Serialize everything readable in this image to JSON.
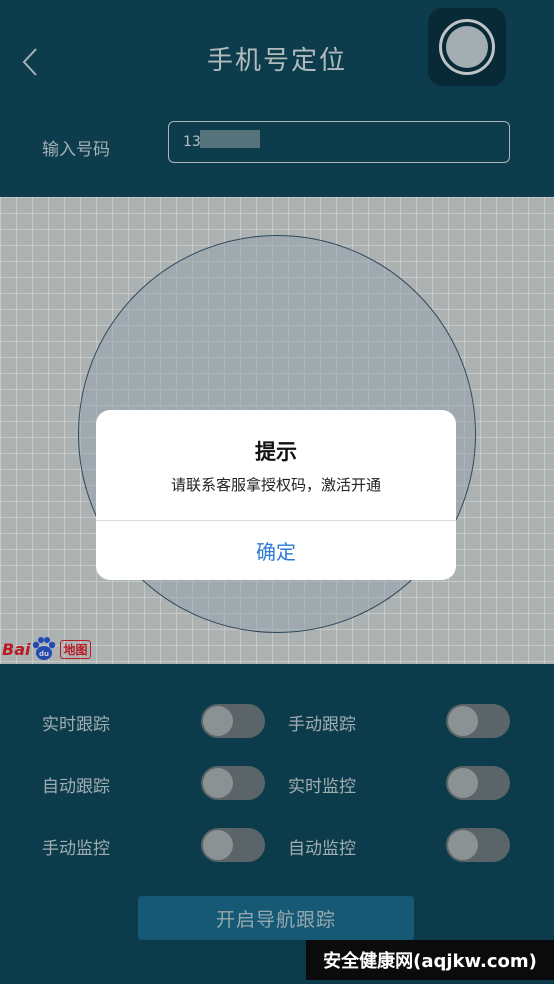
{
  "header": {
    "title": "手机号定位",
    "phone_label": "输入号码",
    "phone_value": "13"
  },
  "toggles": [
    {
      "label": "实时跟踪",
      "on": false
    },
    {
      "label": "手动跟踪",
      "on": false
    },
    {
      "label": "自动跟踪",
      "on": false
    },
    {
      "label": "实时监控",
      "on": false
    },
    {
      "label": "手动监控",
      "on": false
    },
    {
      "label": "自动监控",
      "on": false
    }
  ],
  "nav_button": "开启导航跟踪",
  "dialog": {
    "title": "提示",
    "message": "请联系客服拿授权码，激活开通",
    "ok": "确定"
  },
  "baidu": {
    "bai": "Bai",
    "map": "地图"
  },
  "watermark": "安全健康网(aqjkw.com)",
  "colors": {
    "background": "#0f4a5c",
    "dialog_button": "#2e7bd6",
    "nav_button": "#1a6d8f"
  }
}
